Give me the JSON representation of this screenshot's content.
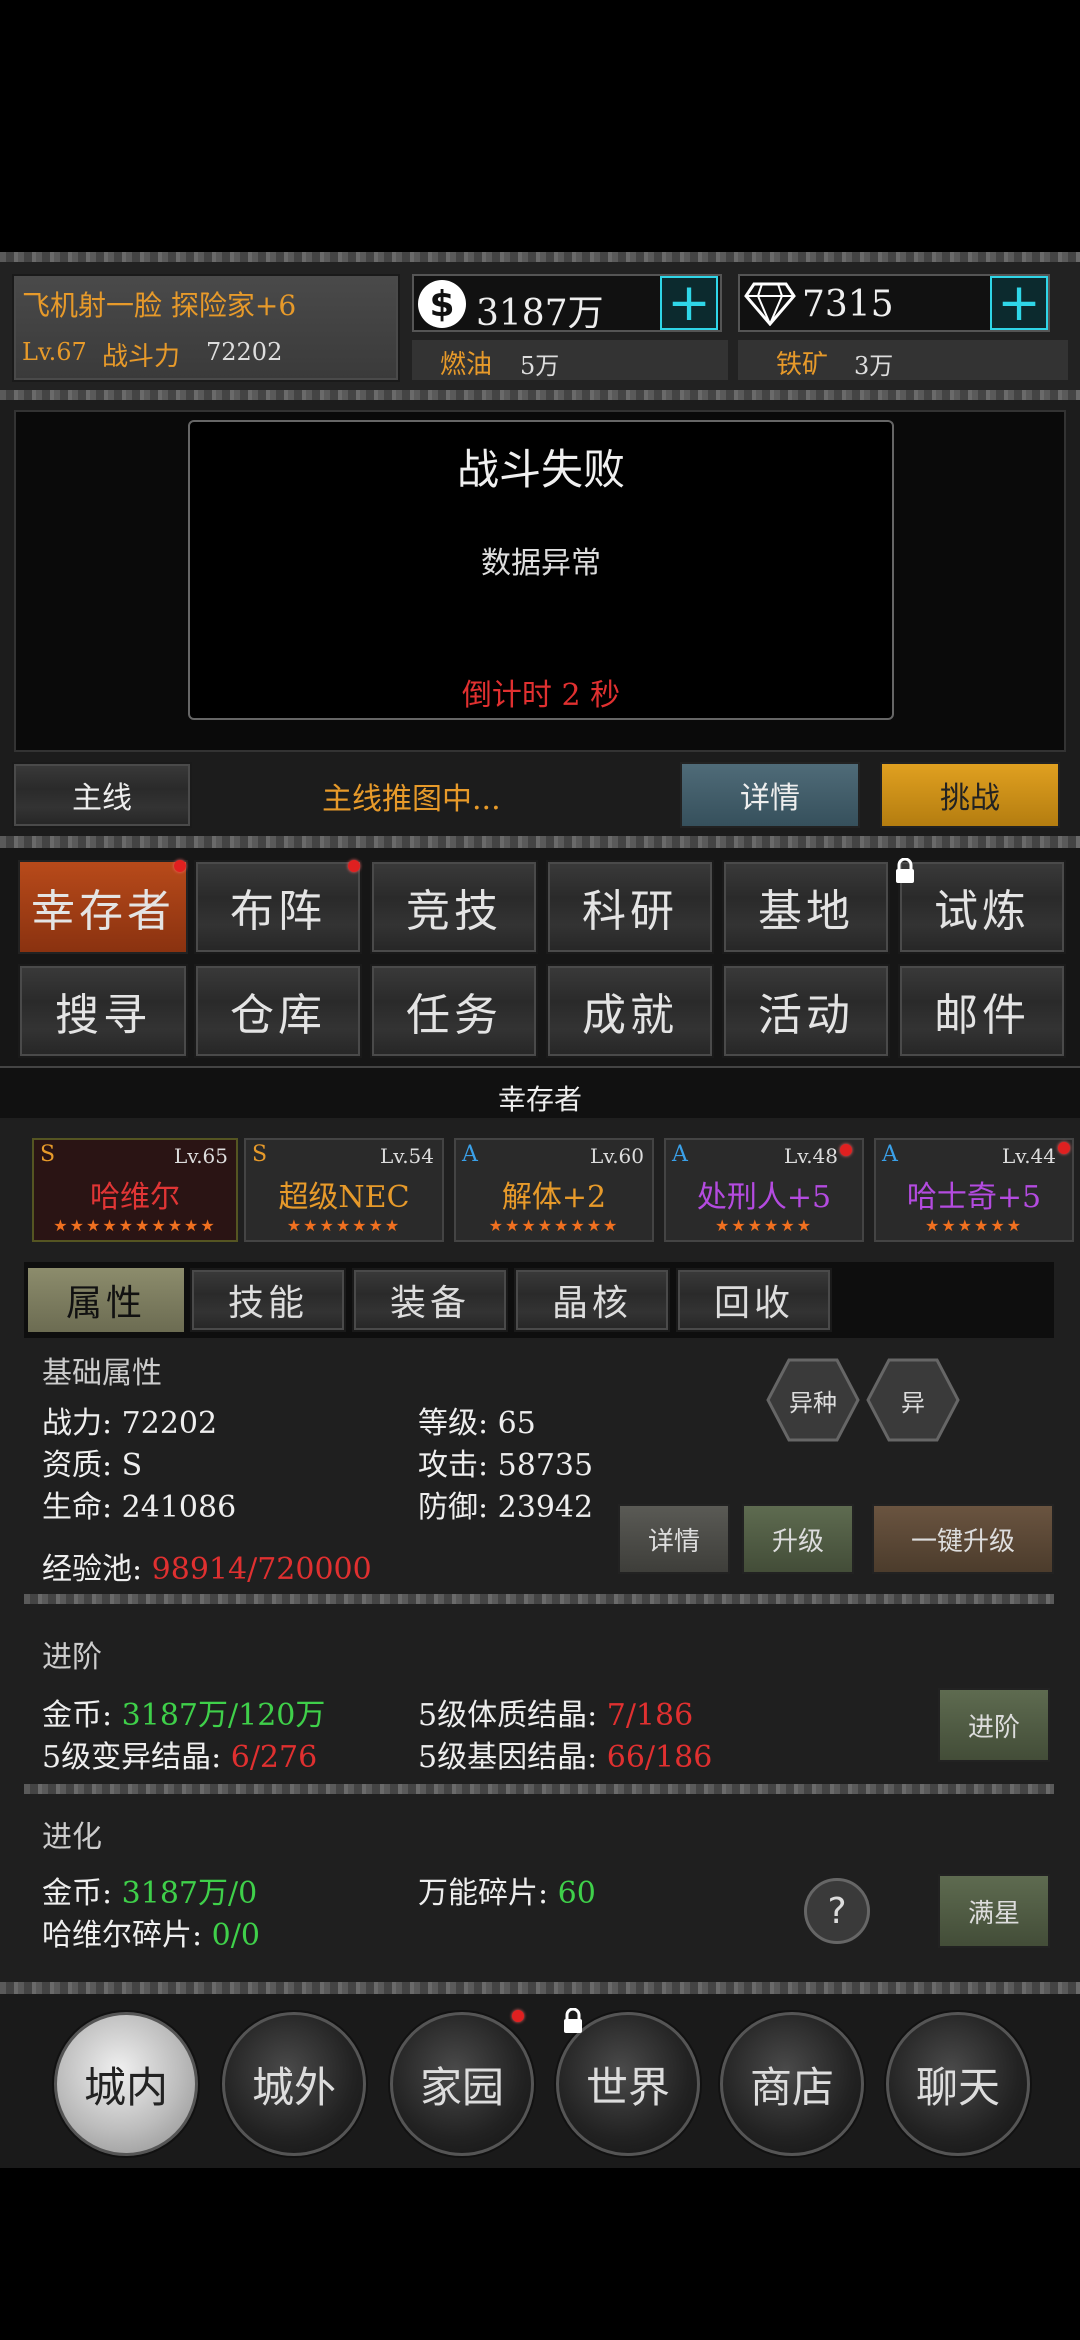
{
  "header": {
    "player_name": "飞机射一脸 探险家+6",
    "level": "Lv.67",
    "power_label": "战斗力",
    "power_value": "72202",
    "gold": "3187万",
    "gems": "7315",
    "fuel_label": "燃油",
    "fuel_value": "5万",
    "ore_label": "铁矿",
    "ore_value": "3万",
    "plus_glyph": "+"
  },
  "battle": {
    "title": "战斗失败",
    "message": "数据异常",
    "countdown": "倒计时 2 秒"
  },
  "mainline": {
    "main_btn": "主线",
    "status": "主线推图中...",
    "detail_btn": "详情",
    "challenge_btn": "挑战"
  },
  "features": {
    "row1": [
      "幸存者",
      "布阵",
      "竞技",
      "科研",
      "基地",
      "试炼"
    ],
    "row2": [
      "搜寻",
      "仓库",
      "任务",
      "成就",
      "活动",
      "邮件"
    ]
  },
  "section_title": "幸存者",
  "heroes": [
    {
      "grade": "S",
      "level": "Lv.65",
      "name": "哈维尔",
      "stars": "★★★★★★★★★★",
      "color": "#e03535"
    },
    {
      "grade": "S",
      "level": "Lv.54",
      "name": "超级NEC",
      "stars": "★★★★★★★",
      "color": "#e79a2a"
    },
    {
      "grade": "A",
      "level": "Lv.60",
      "name": "解体+2",
      "stars": "★★★★★★★★",
      "color": "#e79a2a"
    },
    {
      "grade": "A",
      "level": "Lv.48",
      "name": "处刑人+5",
      "stars": "★★★★★★",
      "color": "#b44be0"
    },
    {
      "grade": "A",
      "level": "Lv.44",
      "name": "哈士奇+5",
      "stars": "★★★★★★",
      "color": "#b44be0"
    }
  ],
  "sub_tabs": [
    "属性",
    "技能",
    "装备",
    "晶核",
    "回收"
  ],
  "attributes": {
    "heading": "基础属性",
    "power": "战力: 72202",
    "level": "等级: 65",
    "aptitude": "资质: S",
    "attack": "攻击: 58735",
    "hp": "生命: 241086",
    "defense": "防御: 23942",
    "exp_label": "经验池: ",
    "exp_value": "98914/720000",
    "mutant_btn1": "异种",
    "mutant_btn2": "异",
    "detail_btn": "详情",
    "upgrade_btn": "升级",
    "oneclick_btn": "一键升级"
  },
  "advance": {
    "heading": "进阶",
    "gold_label": "金币: ",
    "gold_value": "3187万/120万",
    "body_label": "5级体质结晶: ",
    "body_value": "7/186",
    "mutation_label": "5级变异结晶: ",
    "mutation_value": "6/276",
    "gene_label": "5级基因结晶: ",
    "gene_value": "66/186",
    "btn": "进阶"
  },
  "evolve": {
    "heading": "进化",
    "gold_label": "金币: ",
    "gold_value": "3187万/0",
    "universal_label": "万能碎片: ",
    "universal_value": "60",
    "frag_label": "哈维尔碎片: ",
    "frag_value": "0/0",
    "help": "?",
    "btn": "满星"
  },
  "bottom_nav": [
    "城内",
    "城外",
    "家园",
    "世界",
    "商店",
    "聊天"
  ],
  "colors": {
    "accent_orange": "#e79a2a",
    "red": "#e03030",
    "green": "#3fd04a",
    "cyan": "#2fd6e8"
  }
}
